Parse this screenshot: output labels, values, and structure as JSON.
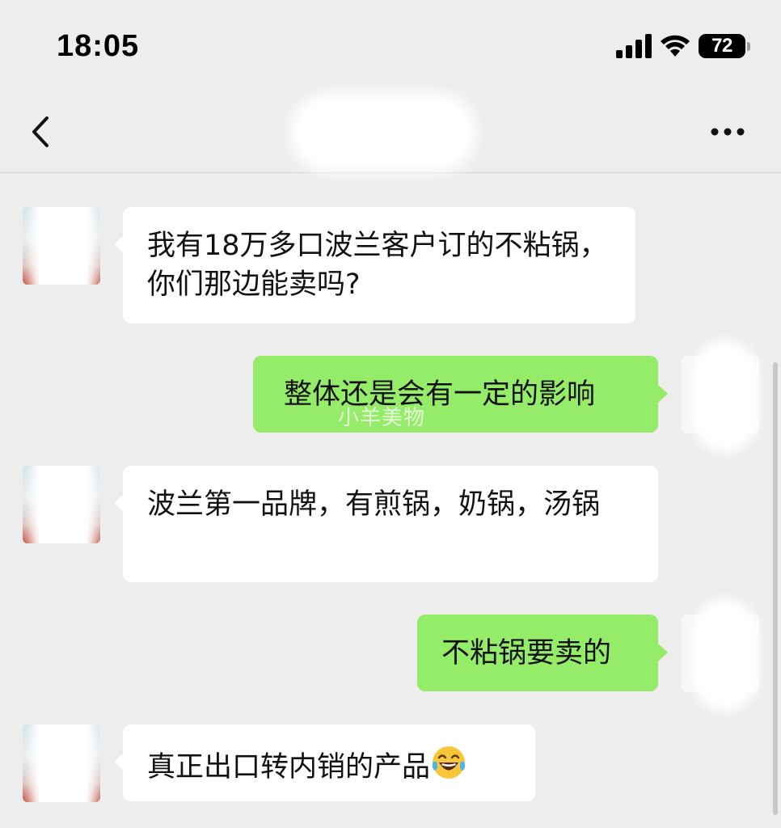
{
  "status_bar": {
    "time": "18:05",
    "battery": "72",
    "icons": [
      "cellular-signal-icon",
      "wifi-icon",
      "battery-icon"
    ]
  },
  "nav": {
    "back_icon": "chevron-left-icon",
    "more_icon": "more-horizontal-icon"
  },
  "messages": [
    {
      "side": "left",
      "text": "我有18万多口波兰客户订的不粘锅，你们那边能卖吗?"
    },
    {
      "side": "right",
      "text": "整体还是会有一定的影响"
    },
    {
      "side": "left",
      "text": "波兰第一品牌，有煎锅，奶锅，汤锅"
    },
    {
      "side": "right",
      "text": "不粘锅要卖的"
    },
    {
      "side": "left",
      "text": "真正出口转内销的产品",
      "emoji": "laughing-tears-emoji-icon"
    }
  ],
  "watermark": "小羊美物",
  "colors": {
    "background": "#ededed",
    "incoming_bubble": "#ffffff",
    "outgoing_bubble": "#95ec69"
  }
}
